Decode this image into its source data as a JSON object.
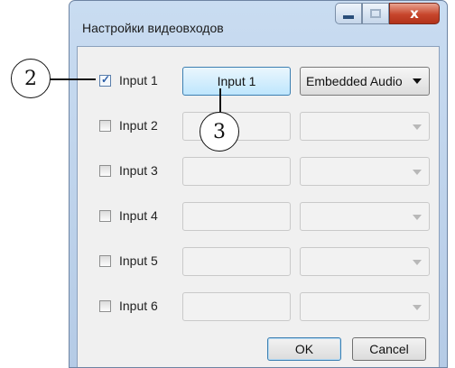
{
  "window": {
    "title": "Настройки видеовходов",
    "close_glyph": "x"
  },
  "inputs": [
    {
      "label": "Input 1",
      "checked": true,
      "name_value": "Input 1",
      "audio": "Embedded Audio"
    },
    {
      "label": "Input 2",
      "checked": false,
      "name_value": "",
      "audio": ""
    },
    {
      "label": "Input 3",
      "checked": false,
      "name_value": "",
      "audio": ""
    },
    {
      "label": "Input 4",
      "checked": false,
      "name_value": "",
      "audio": ""
    },
    {
      "label": "Input 5",
      "checked": false,
      "name_value": "",
      "audio": ""
    },
    {
      "label": "Input 6",
      "checked": false,
      "name_value": "",
      "audio": ""
    }
  ],
  "buttons": {
    "ok": "OK",
    "cancel": "Cancel"
  },
  "callouts": {
    "a": "2",
    "b": "3"
  }
}
